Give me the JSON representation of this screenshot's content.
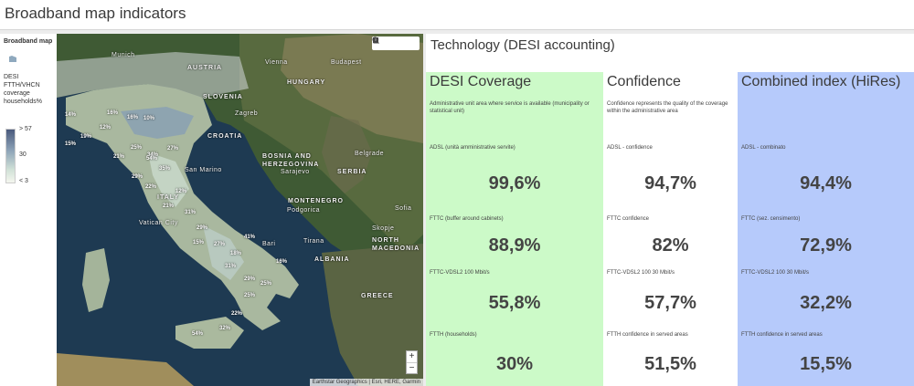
{
  "header": {
    "title": "Broadband map indicators"
  },
  "legend": {
    "title": "Broadband map",
    "field": "DESI FTTH/VHCN coverage households%",
    "max_label": "> 57",
    "mid_label": "30",
    "min_label": "< 3"
  },
  "map": {
    "countries": [
      "AUSTRIA",
      "HUNGARY",
      "SLOVENIA",
      "CROATIA",
      "BOSNIA AND HERZEGOVINA",
      "SERBIA",
      "MONTENEGRO",
      "ALBANIA",
      "NORTH MACEDONIA",
      "GREECE",
      "ITALY"
    ],
    "cities": [
      "Munich",
      "Vienna",
      "Budapest",
      "Zagreb",
      "Belgrade",
      "Sarajevo",
      "Podgorica",
      "Skopje",
      "Tirana",
      "San Marino",
      "Vatican City",
      "Bari",
      "Sofia"
    ],
    "percent_labels": [
      "14%",
      "16%",
      "16%",
      "10%",
      "12%",
      "19%",
      "15%",
      "25%",
      "21%",
      "34%",
      "27%",
      "35%",
      "29%",
      "22%",
      "12%",
      "21%",
      "31%",
      "54%",
      "29%",
      "27%",
      "18%",
      "16%",
      "41%",
      "15%",
      "31%",
      "29%",
      "25%",
      "25%",
      "22%",
      "32%",
      "54%"
    ],
    "attribution": "Earthstar Geographics | Esri, HERE, Garmin",
    "tools": [
      "search-icon",
      "home-icon",
      "list-icon",
      "grid-icon"
    ],
    "zoom_in": "+",
    "zoom_out": "−"
  },
  "panel": {
    "title": "Technology (DESI accounting)",
    "columns": [
      {
        "heading": "DESI Coverage",
        "description": "Administrative unit area where service is available (municipality or statistical unit)",
        "color": "#ccfac8",
        "metrics": [
          {
            "label": "ADSL (unità amministrative servite)",
            "value": "99,6%"
          },
          {
            "label": "FTTC (buffer around cabinets)",
            "value": "88,9%"
          },
          {
            "label": "FTTC-VDSL2 100  Mbit/s",
            "value": "55,8%"
          },
          {
            "label": "FTTH (households)",
            "value": "30%"
          }
        ]
      },
      {
        "heading": "Confidence",
        "description": "Confidence represents the quality of the coverage within the administrative area",
        "color": "#ffffff",
        "metrics": [
          {
            "label": "ADSL - confidence",
            "value": "94,7%"
          },
          {
            "label": "FTTC confidence",
            "value": "82%"
          },
          {
            "label": "FTTC-VDSL2 100  30 Mbit/s",
            "value": "57,7%"
          },
          {
            "label": "FTTH confidence in served areas",
            "value": "51,5%"
          }
        ]
      },
      {
        "heading": "Combined index (HiRes)",
        "description": "",
        "color": "#b6cafb",
        "metrics": [
          {
            "label": "ADSL - combinato",
            "value": "94,4%"
          },
          {
            "label": "FTTC (sez. censimento)",
            "value": "72,9%"
          },
          {
            "label": "FTTC-VDSL2 100  30 Mbit/s",
            "value": "32,2%"
          },
          {
            "label": "FTTH confidence in served areas",
            "value": "15,5%"
          }
        ]
      }
    ]
  }
}
